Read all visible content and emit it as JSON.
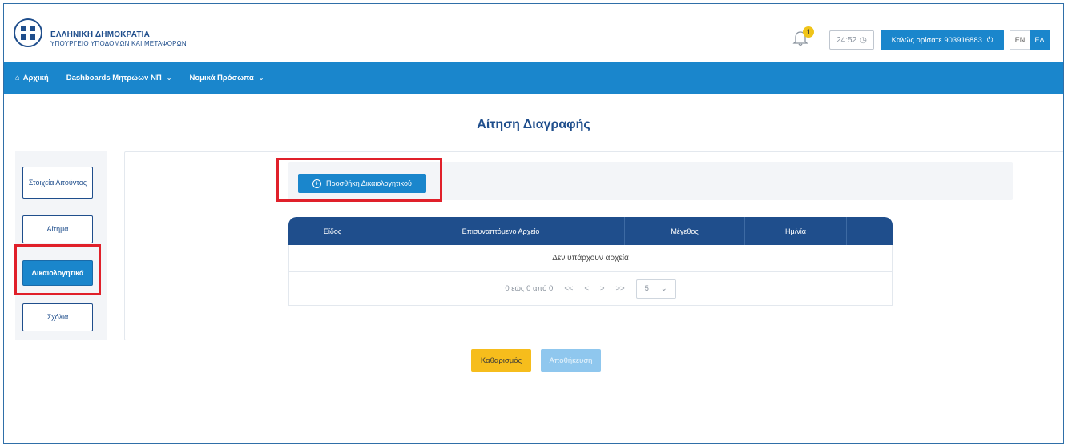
{
  "header": {
    "brand_line1": "ΕΛΛΗΝΙΚΗ ΔΗΜΟΚΡΑΤΙΑ",
    "brand_line2": "ΥΠΟΥΡΓΕΙΟ ΥΠΟΔΟΜΩΝ ΚΑΙ ΜΕΤΑΦΟΡΩΝ",
    "notification_count": "1",
    "timer": "24:52",
    "welcome": "Καλώς ορίσατε 903916883",
    "lang_en": "EN",
    "lang_el": "ΕΛ"
  },
  "nav": {
    "home": "Αρχική",
    "dashboards": "Dashboards Μητρώων ΝΠ",
    "legal_entities": "Νομικά Πρόσωπα"
  },
  "page": {
    "title": "Αίτηση Διαγραφής"
  },
  "sidebar": {
    "items": [
      {
        "label": "Στοιχεία Αιτούντος"
      },
      {
        "label": "Αίτημα"
      },
      {
        "label": "Δικαιολογητικά"
      },
      {
        "label": "Σχόλια"
      }
    ]
  },
  "main": {
    "add_button": "Προσθήκη Δικαιολογητικού",
    "table": {
      "columns": [
        "Είδος",
        "Επισυναπτόμενο Αρχείο",
        "Μέγεθος",
        "Ημ/νία",
        ""
      ],
      "empty_text": "Δεν υπάρχουν αρχεία"
    },
    "pager": {
      "range": "0 εώς 0 από 0",
      "first": "<<",
      "prev": "<",
      "next": ">",
      "last": ">>",
      "page_size": "5"
    }
  },
  "actions": {
    "clear": "Καθαρισμός",
    "save": "Αποθήκευση"
  },
  "colors": {
    "primary": "#1a86cc",
    "dark_blue": "#1f4e8c",
    "clear_yellow": "#f6bd1c",
    "highlight_red": "#e0202a"
  }
}
